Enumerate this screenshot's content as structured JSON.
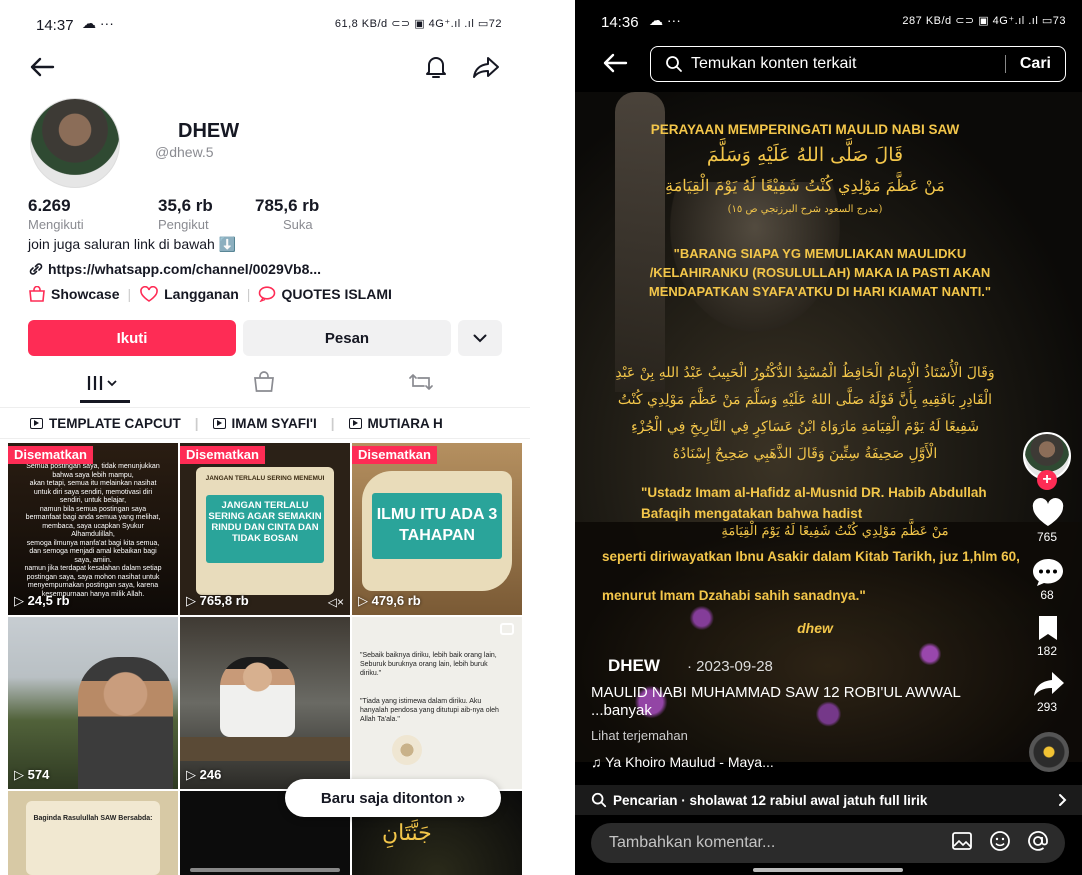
{
  "left": {
    "status": {
      "time": "14:37",
      "cloud": "☁ ···",
      "right": "61,8 KB/d  ⊂⊃ ▣ 4G⁺.ıl .ıl ▭72"
    },
    "profile": {
      "name": "DHEW",
      "handle": "@dhew.5",
      "stats": [
        {
          "value": "6.269",
          "label": "Mengikuti"
        },
        {
          "value": "35,6 rb",
          "label": "Pengikut"
        },
        {
          "value": "785,6 rb",
          "label": "Suka"
        }
      ],
      "bio": "join juga saluran link di bawah ⬇️",
      "link": "https://whatsapp.com/channel/0029Vb8...",
      "chips": [
        "Showcase",
        "Langganan",
        "QUOTES ISLAMI"
      ]
    },
    "buttons": {
      "follow": "Ikuti",
      "message": "Pesan"
    },
    "playlists": [
      "TEMPLATE CAPCUT",
      "IMAM SYAFI'I",
      "MUTIARA H"
    ],
    "grid": {
      "pinned_label": "Disematkan",
      "tiles": [
        {
          "views": "24,5 rb",
          "pinned": true
        },
        {
          "views": "765,8 rb",
          "pinned": true,
          "header": "JANGAN TERLALU SERING MENEMUI",
          "text": "JANGAN TERLALU SERING AGAR SEMAKIN RINDU DAN CINTA DAN TIDAK BOSAN"
        },
        {
          "views": "479,6 rb",
          "pinned": true,
          "text": "ILMU ITU ADA 3 TAHAPAN"
        },
        {
          "views": "574",
          "pinned": false
        },
        {
          "views": "246",
          "pinned": false
        },
        {
          "views": "",
          "pinned": false,
          "quote1": "\"Sebaik baiknya diriku, lebih baik orang lain, Seburuk buruknya orang lain, lebih buruk diriku.\"",
          "quote2": "\"Tiada yang istimewa dalam diriku. Aku hanyalah pendosa yang ditutupi aib-nya oleh Allah Ta'ala.\""
        },
        {
          "views": "",
          "pinned": false,
          "text": "Baginda Rasulullah SAW Bersabda:"
        },
        {
          "views": "",
          "pinned": false
        },
        {
          "views": "",
          "pinned": false
        }
      ]
    },
    "toast": "Baru saja ditonton »"
  },
  "right": {
    "status": {
      "time": "14:36",
      "cloud": "☁ ···",
      "right": "287 KB/d  ⊂⊃ ▣ 4G⁺.ıl .ıl ▭73"
    },
    "search": {
      "placeholder": "Temukan konten terkait",
      "button": "Cari"
    },
    "video": {
      "title": "PERAYAAN MEMPERINGATI MAULID NABI SAW",
      "arabic1": "قَالَ صَلَّى اللهُ عَلَيْهِ وَسَلَّمَ",
      "arabic2": "مَنْ عَظَّمَ مَوْلِدِي كُنْتُ شَفِيْعًا لَهُ يَوْمَ الْقِيَامَةِ",
      "arabic_src": "(مدرج السعود شرح البرزنجي ص ١٥)",
      "quote": "\"BARANG SIAPA YG MEMULIAKAN MAULIDKU /KELAHIRANKU (ROSULULLAH) MAKA IA PASTI AKAN MENDAPATKAN SYAFA'ATKU DI HARI KIAMAT NANTI.\"",
      "arabic3": "وَقَالَ الْأُسْتَاذُ الْإِمَامُ الْحَافِظُ الْمُسْنِدُ الدُّكْتُورُ الْحَبِيبُ عَبْدُ اللهِ بِنْ عَبْدِ الْقَادِرِ بَافَقِيهِ بِأَنَّ قَوْلَهُ صَلَّى اللهُ عَلَيْهِ وَسَلَّمَ مَنْ عَظَّمَ مَوْلِدِي كُنْتُ شَفِيعًا لَهُ يَوْمَ الْقِيَامَةِ مَارَوَاهُ ابْنُ عَسَاكِرٍ فِي التَّارِيخِ فِي الْجُزْءِ الْأَوَّلِ صَحِيفَةُ سِتِّينَ وَقَالَ الذَّهَبِي صَحِيحٌ إِسْنَادُهُ",
      "latin1": "\"Ustadz Imam al-Hafidz al-Musnid DR. Habib Abdullah Bafaqih mengatakan bahwa hadist",
      "arabic4": "مَنْ عَظَّمَ مَوْلِدِي كُنْتُ شَفِيعًا لَهُ يَوْمَ الْقِيَامَةِ",
      "latin2": "seperti diriwayatkan Ibnu Asakir dalam Kitab Tarikh, juz 1,hlm 60,",
      "latin3": "menurut Imam Dzahabi sahih sanadnya.\"",
      "watermark": "dhew"
    },
    "actions": {
      "likes": "765",
      "comments": "68",
      "saves": "182",
      "shares": "293"
    },
    "caption": {
      "author": "DHEW",
      "date": "· 2023-09-28",
      "desc": "MAULID NABI MUHAMMAD SAW 12 ROBI'UL AWWAL ...banyak",
      "translate": "Lihat terjemahan",
      "music": "♫ Ya Khoiro Maulud - Maya..."
    },
    "suggestion": "Pencarian · sholawat 12 rabiul awal jatuh full lirik",
    "comment_placeholder": "Tambahkan komentar...",
    "colors": {
      "accent": "#fe2c55",
      "gold": "#f3c64a"
    }
  }
}
